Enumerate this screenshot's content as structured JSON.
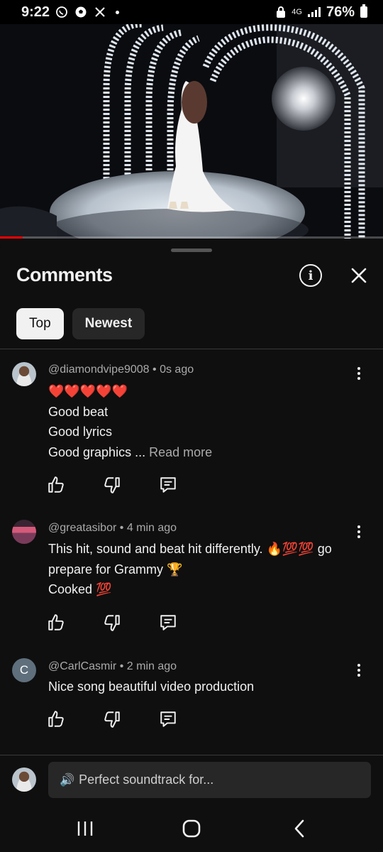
{
  "status_bar": {
    "time": "9:22",
    "network": "4G",
    "battery": "76%",
    "left_icons": [
      "whatsapp-icon",
      "soccer-icon",
      "x-icon",
      "dot-icon"
    ],
    "right_icons": [
      "lock-icon",
      "network-4g-icon",
      "signal-icon",
      "battery-icon"
    ]
  },
  "video": {
    "progress_fraction": 0.06
  },
  "comments_panel": {
    "title": "Comments",
    "info_label": "i",
    "close_label": "✕",
    "chips": [
      {
        "label": "Top",
        "active": true
      },
      {
        "label": "Newest",
        "active": false
      }
    ]
  },
  "comments": [
    {
      "author": "@diamondvipe9008",
      "time": "0s ago",
      "avatar": "photo",
      "lines": [
        "❤️❤️❤️❤️❤️",
        "Good beat",
        "Good lyrics",
        "Good graphics ..."
      ],
      "read_more": "Read more"
    },
    {
      "author": "@greatasibor",
      "time": "4 min ago",
      "avatar": "pixel",
      "lines": [
        "This hit, sound and beat hit differently. 🔥💯💯 go",
        "prepare for Grammy 🏆",
        "Cooked 💯"
      ]
    },
    {
      "author": "@CarlCasmir",
      "time": "2 min ago",
      "avatar_letter": "C",
      "lines": [
        "Nice song beautiful video production"
      ]
    }
  ],
  "meta_separator": "•",
  "composer": {
    "placeholder": "Perfect soundtrack for...",
    "speaker_icon": "🔊"
  },
  "nav": [
    "recent-apps-icon",
    "home-icon",
    "back-icon"
  ],
  "colors": {
    "accent_red": "#ff0000",
    "background": "#0f0f0f",
    "chip_bg": "#272727",
    "secondary_text": "#aaaaaa",
    "link_blue": "#3ea6ff"
  }
}
